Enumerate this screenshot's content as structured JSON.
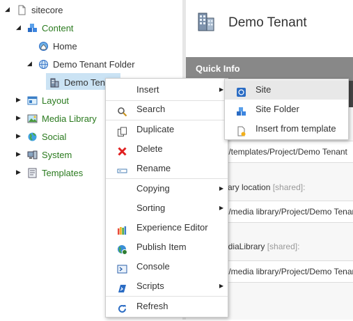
{
  "tree": {
    "root": "sitecore",
    "content": "Content",
    "home": "Home",
    "tenant_folder": "Demo Tenant Folder",
    "tenant": "Demo Tenant",
    "layout": "Layout",
    "media": "Media Library",
    "social": "Social",
    "system": "System",
    "templates": "Templates"
  },
  "header": {
    "title": "Demo Tenant"
  },
  "quick_info": {
    "title": "Quick Info",
    "field1_value": "ore/templates/Project/Demo Tenant",
    "field2_label": "library location",
    "field2_shared": "[shared]:",
    "field2_value": "ore/media library/Project/Demo Tenant",
    "field3_label": "MediaLibrary",
    "field3_shared": "[shared]:",
    "field3_value": "ore/media library/Project/Demo Tenant"
  },
  "context_menu": {
    "insert": "Insert",
    "search": "Search",
    "duplicate": "Duplicate",
    "delete": "Delete",
    "rename": "Rename",
    "copying": "Copying",
    "sorting": "Sorting",
    "experience_editor": "Experience Editor",
    "publish_item": "Publish Item",
    "console": "Console",
    "scripts": "Scripts",
    "refresh": "Refresh"
  },
  "insert_submenu": {
    "site": "Site",
    "site_folder": "Site Folder",
    "insert_from_template": "Insert from template"
  },
  "colors": {
    "accent_green": "#2a7a1e",
    "selection": "#cbe3f4",
    "quick_info_bar": "#888888",
    "delete_red": "#e02020"
  }
}
